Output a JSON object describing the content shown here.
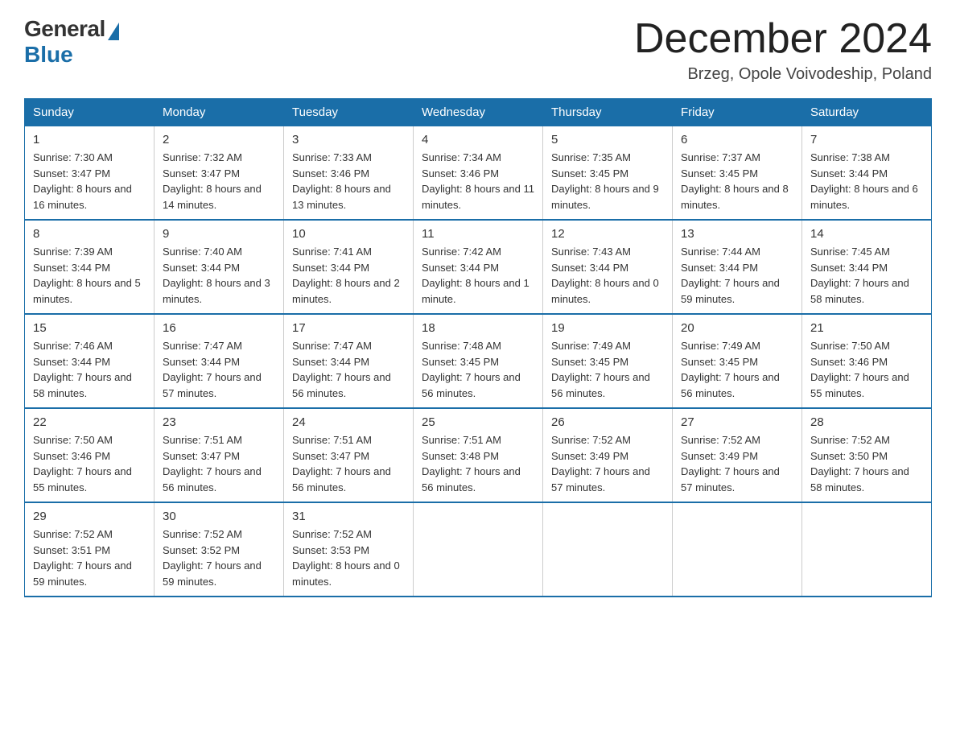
{
  "logo": {
    "general": "General",
    "blue": "Blue"
  },
  "title": "December 2024",
  "location": "Brzeg, Opole Voivodeship, Poland",
  "days_of_week": [
    "Sunday",
    "Monday",
    "Tuesday",
    "Wednesday",
    "Thursday",
    "Friday",
    "Saturday"
  ],
  "weeks": [
    [
      {
        "num": "1",
        "sunrise": "7:30 AM",
        "sunset": "3:47 PM",
        "daylight": "8 hours and 16 minutes."
      },
      {
        "num": "2",
        "sunrise": "7:32 AM",
        "sunset": "3:47 PM",
        "daylight": "8 hours and 14 minutes."
      },
      {
        "num": "3",
        "sunrise": "7:33 AM",
        "sunset": "3:46 PM",
        "daylight": "8 hours and 13 minutes."
      },
      {
        "num": "4",
        "sunrise": "7:34 AM",
        "sunset": "3:46 PM",
        "daylight": "8 hours and 11 minutes."
      },
      {
        "num": "5",
        "sunrise": "7:35 AM",
        "sunset": "3:45 PM",
        "daylight": "8 hours and 9 minutes."
      },
      {
        "num": "6",
        "sunrise": "7:37 AM",
        "sunset": "3:45 PM",
        "daylight": "8 hours and 8 minutes."
      },
      {
        "num": "7",
        "sunrise": "7:38 AM",
        "sunset": "3:44 PM",
        "daylight": "8 hours and 6 minutes."
      }
    ],
    [
      {
        "num": "8",
        "sunrise": "7:39 AM",
        "sunset": "3:44 PM",
        "daylight": "8 hours and 5 minutes."
      },
      {
        "num": "9",
        "sunrise": "7:40 AM",
        "sunset": "3:44 PM",
        "daylight": "8 hours and 3 minutes."
      },
      {
        "num": "10",
        "sunrise": "7:41 AM",
        "sunset": "3:44 PM",
        "daylight": "8 hours and 2 minutes."
      },
      {
        "num": "11",
        "sunrise": "7:42 AM",
        "sunset": "3:44 PM",
        "daylight": "8 hours and 1 minute."
      },
      {
        "num": "12",
        "sunrise": "7:43 AM",
        "sunset": "3:44 PM",
        "daylight": "8 hours and 0 minutes."
      },
      {
        "num": "13",
        "sunrise": "7:44 AM",
        "sunset": "3:44 PM",
        "daylight": "7 hours and 59 minutes."
      },
      {
        "num": "14",
        "sunrise": "7:45 AM",
        "sunset": "3:44 PM",
        "daylight": "7 hours and 58 minutes."
      }
    ],
    [
      {
        "num": "15",
        "sunrise": "7:46 AM",
        "sunset": "3:44 PM",
        "daylight": "7 hours and 58 minutes."
      },
      {
        "num": "16",
        "sunrise": "7:47 AM",
        "sunset": "3:44 PM",
        "daylight": "7 hours and 57 minutes."
      },
      {
        "num": "17",
        "sunrise": "7:47 AM",
        "sunset": "3:44 PM",
        "daylight": "7 hours and 56 minutes."
      },
      {
        "num": "18",
        "sunrise": "7:48 AM",
        "sunset": "3:45 PM",
        "daylight": "7 hours and 56 minutes."
      },
      {
        "num": "19",
        "sunrise": "7:49 AM",
        "sunset": "3:45 PM",
        "daylight": "7 hours and 56 minutes."
      },
      {
        "num": "20",
        "sunrise": "7:49 AM",
        "sunset": "3:45 PM",
        "daylight": "7 hours and 56 minutes."
      },
      {
        "num": "21",
        "sunrise": "7:50 AM",
        "sunset": "3:46 PM",
        "daylight": "7 hours and 55 minutes."
      }
    ],
    [
      {
        "num": "22",
        "sunrise": "7:50 AM",
        "sunset": "3:46 PM",
        "daylight": "7 hours and 55 minutes."
      },
      {
        "num": "23",
        "sunrise": "7:51 AM",
        "sunset": "3:47 PM",
        "daylight": "7 hours and 56 minutes."
      },
      {
        "num": "24",
        "sunrise": "7:51 AM",
        "sunset": "3:47 PM",
        "daylight": "7 hours and 56 minutes."
      },
      {
        "num": "25",
        "sunrise": "7:51 AM",
        "sunset": "3:48 PM",
        "daylight": "7 hours and 56 minutes."
      },
      {
        "num": "26",
        "sunrise": "7:52 AM",
        "sunset": "3:49 PM",
        "daylight": "7 hours and 57 minutes."
      },
      {
        "num": "27",
        "sunrise": "7:52 AM",
        "sunset": "3:49 PM",
        "daylight": "7 hours and 57 minutes."
      },
      {
        "num": "28",
        "sunrise": "7:52 AM",
        "sunset": "3:50 PM",
        "daylight": "7 hours and 58 minutes."
      }
    ],
    [
      {
        "num": "29",
        "sunrise": "7:52 AM",
        "sunset": "3:51 PM",
        "daylight": "7 hours and 59 minutes."
      },
      {
        "num": "30",
        "sunrise": "7:52 AM",
        "sunset": "3:52 PM",
        "daylight": "7 hours and 59 minutes."
      },
      {
        "num": "31",
        "sunrise": "7:52 AM",
        "sunset": "3:53 PM",
        "daylight": "8 hours and 0 minutes."
      },
      null,
      null,
      null,
      null
    ]
  ],
  "labels": {
    "sunrise": "Sunrise:",
    "sunset": "Sunset:",
    "daylight": "Daylight:"
  }
}
